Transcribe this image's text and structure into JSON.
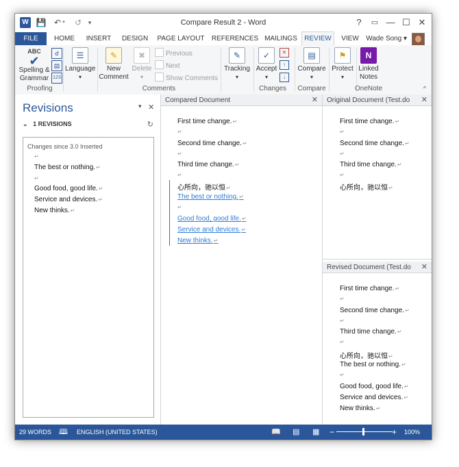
{
  "window": {
    "title": "Compare Result 2 - Word",
    "help": "?",
    "minimize": "—",
    "maximize": "☐",
    "close": "✕"
  },
  "qat": {
    "app_icon": "W",
    "save_icon": "floppy-icon",
    "undo_icon": "undo-icon",
    "redo_icon": "redo-icon"
  },
  "tabs": [
    "FILE",
    "HOME",
    "INSERT",
    "DESIGN",
    "PAGE LAYOUT",
    "REFERENCES",
    "MAILINGS",
    "REVIEW",
    "VIEW"
  ],
  "active_tab": "REVIEW",
  "user": {
    "name": "Wade Song"
  },
  "ribbon": {
    "proofing": {
      "label": "Proofing",
      "spelling": "Spelling &",
      "grammar": "Grammar",
      "abc": "ABC"
    },
    "language": {
      "label": "Language"
    },
    "comments": {
      "label": "Comments",
      "new1": "New",
      "new2": "Comment",
      "delete": "Delete",
      "previous": "Previous",
      "next": "Next",
      "show": "Show Comments"
    },
    "tracking": {
      "label": "Tracking"
    },
    "changes": {
      "label": "Changes",
      "accept": "Accept"
    },
    "compare": {
      "label": "Compare",
      "btn": "Compare"
    },
    "protect": {
      "label": "Protect"
    },
    "onenote": {
      "label": "OneNote",
      "linked1": "Linked",
      "linked2": "Notes"
    }
  },
  "revisions": {
    "title": "Revisions",
    "count": "1 REVISIONS",
    "header": "Changes since 3.0 Inserted",
    "lines": [
      "The best or nothing.",
      "Good food, good life.",
      "Service and devices.",
      "New thinks."
    ]
  },
  "compared": {
    "title": "Compared Document",
    "lines": [
      "First time change.",
      "Second time change.",
      "Third time change.",
      "心所向，驰以恒"
    ],
    "inserted": [
      "The best or nothing.",
      "Good food, good life.",
      "Service and devices.",
      "New thinks."
    ]
  },
  "original": {
    "title": "Original Document (Test.do",
    "lines": [
      "First time change.",
      "Second time change.",
      "Third time change.",
      "心所向，驰以恒"
    ]
  },
  "revised": {
    "title": "Revised Document (Test.do",
    "lines": [
      "First time change.",
      "Second time change.",
      "Third time change.",
      "心所向，驰以恒",
      "The best or nothing.",
      "Good food, good life.",
      "Service and devices.",
      "New thinks."
    ]
  },
  "status": {
    "words": "29 WORDS",
    "language": "ENGLISH (UNITED STATES)",
    "zoom": "100%",
    "minus": "−",
    "plus": "+"
  },
  "paragraph_mark": "↵",
  "colors": {
    "accent": "#2b579a",
    "insertion": "#2b7bd6"
  }
}
